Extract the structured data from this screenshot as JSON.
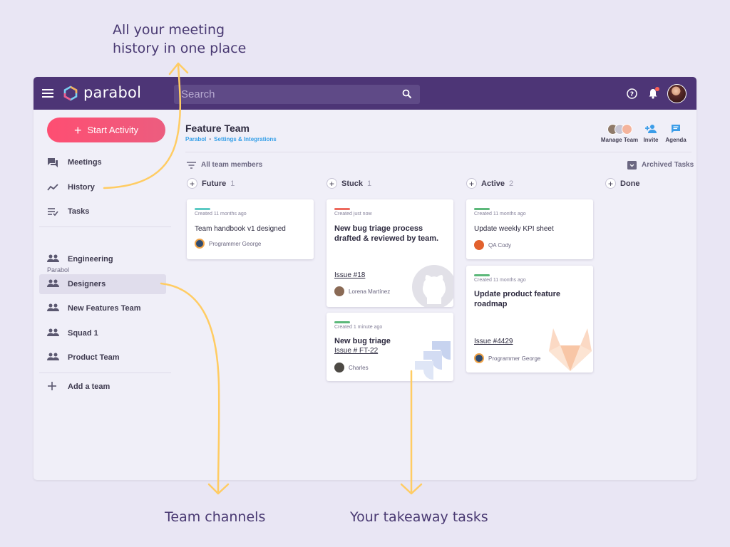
{
  "callouts": {
    "history": "All your meeting\nhistory in one place",
    "channels": "Team channels",
    "tasks": "Your takeaway tasks"
  },
  "topbar": {
    "brand": "parabol",
    "search_placeholder": "Search"
  },
  "sidebar": {
    "start_label": "Start Activity",
    "items": [
      {
        "label": "Meetings",
        "icon": "meetings-icon"
      },
      {
        "label": "History",
        "icon": "history-icon"
      },
      {
        "label": "Tasks",
        "icon": "tasks-icon"
      }
    ],
    "org_label": "Parabol",
    "teams": [
      {
        "label": "Engineering"
      },
      {
        "label": "Designers",
        "active": true
      },
      {
        "label": "New Features Team"
      },
      {
        "label": "Squad 1"
      },
      {
        "label": "Product Team"
      }
    ],
    "add_team": "Add a team"
  },
  "header": {
    "team": "Feature Team",
    "crumb_org": "Parabol",
    "crumb_sep": "•",
    "crumb_settings": "Settings & Integrations",
    "manage": "Manage Team",
    "invite": "Invite",
    "agenda": "Agenda"
  },
  "filters": {
    "members": "All team members",
    "archived": "Archived Tasks"
  },
  "columns": [
    {
      "name": "Future",
      "count": "1"
    },
    {
      "name": "Stuck",
      "count": "1"
    },
    {
      "name": "Active",
      "count": "2"
    },
    {
      "name": "Done",
      "count": ""
    }
  ],
  "cards": {
    "c1": {
      "meta": "Created 11 months ago",
      "title": "Team handbook v1 designed",
      "user": "Programmer George",
      "tag_color": "#5ccac4"
    },
    "c2": {
      "meta": "Created just now",
      "title": "New bug triage process drafted & reviewed by team.",
      "link": "Issue #18",
      "user": "Lorena Martínez",
      "tag_color": "#ed6a5e"
    },
    "c3": {
      "meta": "Created 1 minute ago",
      "title": "New bug triage",
      "link": "Issue # FT-22",
      "user": "Charles",
      "tag_color": "#5cb87a"
    },
    "c4": {
      "meta": "Created 11 months ago",
      "title": "Update weekly KPI sheet",
      "user": "QA Cody",
      "tag_color": "#5cb87a"
    },
    "c5": {
      "meta": "Created 11 months ago",
      "title": "Update product feature roadmap",
      "link": "Issue #4429",
      "user": "Programmer George",
      "tag_color": "#5cb87a"
    }
  },
  "colors": {
    "topbar": "#4d3576",
    "accent": "#fe4e72",
    "callout": "#493972",
    "arrow": "#ffcc63"
  }
}
